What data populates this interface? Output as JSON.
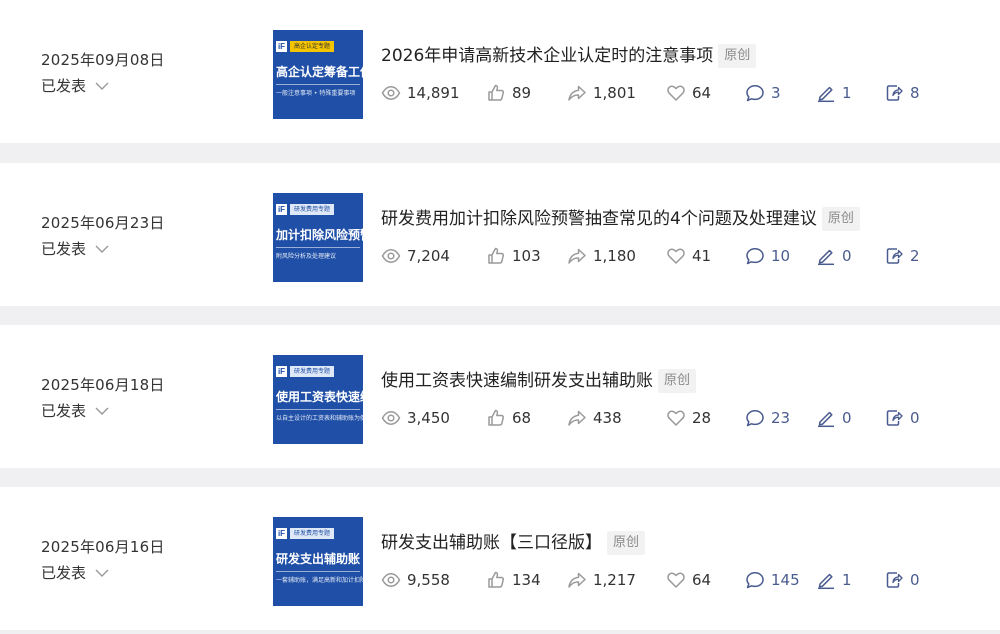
{
  "articles": [
    {
      "date": "2025年09月08日",
      "status": "已发表",
      "title": "2026年申请高新技术企业认定时的注意事项",
      "badge": "原创",
      "thumb": {
        "tag": "高企认定专题",
        "tag_style": "yellow",
        "headline": "高企认定筹备工作",
        "subline": "一般注意事项 • 特殊重要事项"
      },
      "stats": {
        "views": "14,891",
        "likes": "89",
        "shares": "1,801",
        "favorites": "64",
        "comments": "3",
        "edits": "1",
        "reposts": "8"
      }
    },
    {
      "date": "2025年06月23日",
      "status": "已发表",
      "title": "研发费用加计扣除风险预警抽查常见的4个问题及处理建议",
      "badge": "原创",
      "thumb": {
        "tag": "研发费用专题",
        "tag_style": "light",
        "headline": "加计扣除风险预警常见问题",
        "subline": "附风险分析及处理建议"
      },
      "stats": {
        "views": "7,204",
        "likes": "103",
        "shares": "1,180",
        "favorites": "41",
        "comments": "10",
        "edits": "0",
        "reposts": "2"
      }
    },
    {
      "date": "2025年06月18日",
      "status": "已发表",
      "title": "使用工资表快速编制研发支出辅助账",
      "badge": "原创",
      "thumb": {
        "tag": "研发费用专题",
        "tag_style": "light",
        "headline": "使用工资表快速编制",
        "subline": "以自主设计的工资表和辅助账为例"
      },
      "stats": {
        "views": "3,450",
        "likes": "68",
        "shares": "438",
        "favorites": "28",
        "comments": "23",
        "edits": "0",
        "reposts": "0"
      }
    },
    {
      "date": "2025年06月16日",
      "status": "已发表",
      "title": "研发支出辅助账【三口径版】",
      "badge": "原创",
      "thumb": {
        "tag": "研发费用专题",
        "tag_style": "light",
        "headline": "研发支出辅助账",
        "subline": "一套辅助账，满足高新和加计扣除"
      },
      "stats": {
        "views": "9,558",
        "likes": "134",
        "shares": "1,217",
        "favorites": "64",
        "comments": "145",
        "edits": "1",
        "reposts": "0"
      }
    }
  ],
  "colors": {
    "thumb_bg": "#1f4fa6",
    "accent_stat": "#4a5c8f",
    "icon_gray": "#9a9a9a",
    "badge_bg": "#f2f2f2"
  },
  "icons": {
    "views": "eye-icon",
    "likes": "thumbs-up-icon",
    "shares": "share-arrow-icon",
    "favorites": "heart-icon",
    "comments": "comment-icon",
    "edits": "pen-icon",
    "reposts": "repost-icon",
    "status_toggle": "chevron-down-icon"
  }
}
